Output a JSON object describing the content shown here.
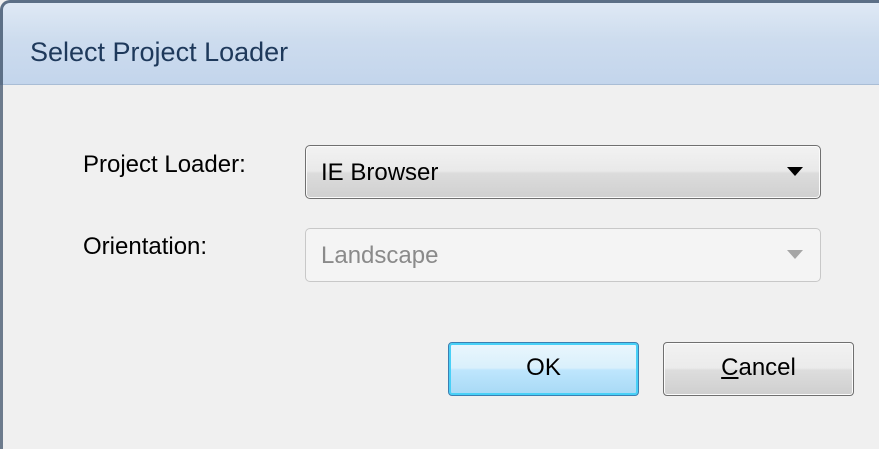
{
  "window": {
    "title": "Select Project Loader"
  },
  "form": {
    "project_loader": {
      "label": "Project Loader:",
      "selected": "IE Browser",
      "enabled": true
    },
    "orientation": {
      "label": "Orientation:",
      "selected": "Landscape",
      "enabled": false
    }
  },
  "buttons": {
    "ok_label": "OK",
    "cancel_label": "Cancel",
    "cancel_access_key": "C",
    "cancel_rest": "ancel"
  },
  "icons": {
    "dropdown_arrow": "chevron-down-icon"
  },
  "colors": {
    "title_text": "#1e395b",
    "title_bar": "#cddcee",
    "ok_focus_border": "#3c7fb1",
    "disabled_text": "#8a8a8a"
  }
}
